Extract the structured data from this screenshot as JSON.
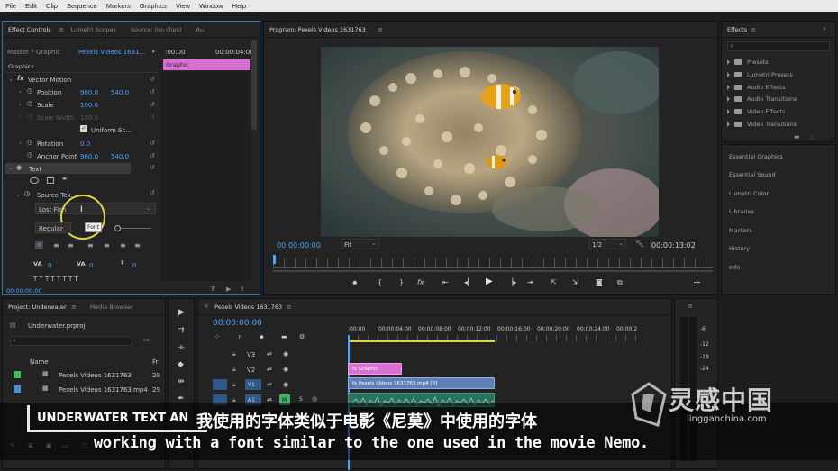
{
  "menu": [
    "File",
    "Edit",
    "Clip",
    "Sequence",
    "Markers",
    "Graphics",
    "View",
    "Window",
    "Help"
  ],
  "effect_controls": {
    "tabs": [
      "Effect Controls",
      "Lumetri Scopes",
      "Source: (no clips)",
      "Au"
    ],
    "master": "Master * Graphic",
    "clip": "Pexels Videos 1631...",
    "ruler_start": ":00:00",
    "ruler_end": "00:00:04:00",
    "graphic_clip": "Graphic",
    "section": "Graphics",
    "vector_motion": "Vector Motion",
    "position_label": "Position",
    "position_x": "960.0",
    "position_y": "540.0",
    "scale_label": "Scale",
    "scale_value": "100.0",
    "scale_width_label": "Scale Width",
    "scale_width_value": "100.0",
    "uniform_scale": "Uniform Sc...",
    "rotation_label": "Rotation",
    "rotation_value": "0.0",
    "anchor_label": "Anchor Point",
    "anchor_x": "960.0",
    "anchor_y": "540.0",
    "text_label": "Text",
    "source_text": "Source Tex...",
    "font_value": "Lost Fish",
    "font_tooltip": "Font",
    "style_value": "Regular",
    "tracking_value": "0",
    "kerning_value": "0",
    "leading_value": "0",
    "timecode": "00:00:00:00"
  },
  "program": {
    "title": "Program: Pexels Videos 1631763",
    "timecode": "00:00:00:00",
    "fit": "Fit",
    "quality": "1/2",
    "duration": "00:00:13:02"
  },
  "effects_panel": {
    "title": "Effects",
    "items": [
      "Presets",
      "Lumetri Presets",
      "Audio Effects",
      "Audio Transitions",
      "Video Effects",
      "Video Transitions"
    ],
    "side_panels": [
      "Essential Graphics",
      "Essential Sound",
      "Lumetri Color",
      "Libraries",
      "Markers",
      "History",
      "Info"
    ]
  },
  "project": {
    "tabs": [
      "Project: Underwater",
      "Media Browser"
    ],
    "file": "Underwater.prproj",
    "col_name": "Name",
    "col_fr": "Fr",
    "items": [
      {
        "name": "Pexels Videos 1631763",
        "fr": "29",
        "color": "#3fbf5a"
      },
      {
        "name": "Pexels Videos 1631763.mp4",
        "fr": "29",
        "color": "#4a8fd6"
      }
    ]
  },
  "timeline": {
    "title": "Pexels Videos 1631763",
    "timecode": "00:00:00:00",
    "ruler": [
      ":00:00",
      "00:00:04:00",
      "00:00:08:00",
      "00:00:12:00",
      "00:00:16:00",
      "00:00:20:00",
      "00:00:24:00",
      "00:00:2"
    ],
    "tracks": [
      "V3",
      "V2",
      "V1",
      "A1"
    ],
    "graphic_clip": "Graphic",
    "video_clip": "Pexels Videos 1631763.mp4 [V]",
    "meter_labels": [
      "-6",
      "-12",
      "-18",
      "-24"
    ],
    "mute": "M",
    "solo": "S"
  },
  "overlay": {
    "title_text": "UNDERWATER TEXT AN",
    "subtitle_cn": "我使用的字体类似于电影《尼莫》中使用的字体",
    "subtitle_en": "working with a font similar to the one used in the movie Nemo.",
    "watermark_cn": "灵感中国",
    "watermark_url": "lingganchina.com"
  }
}
